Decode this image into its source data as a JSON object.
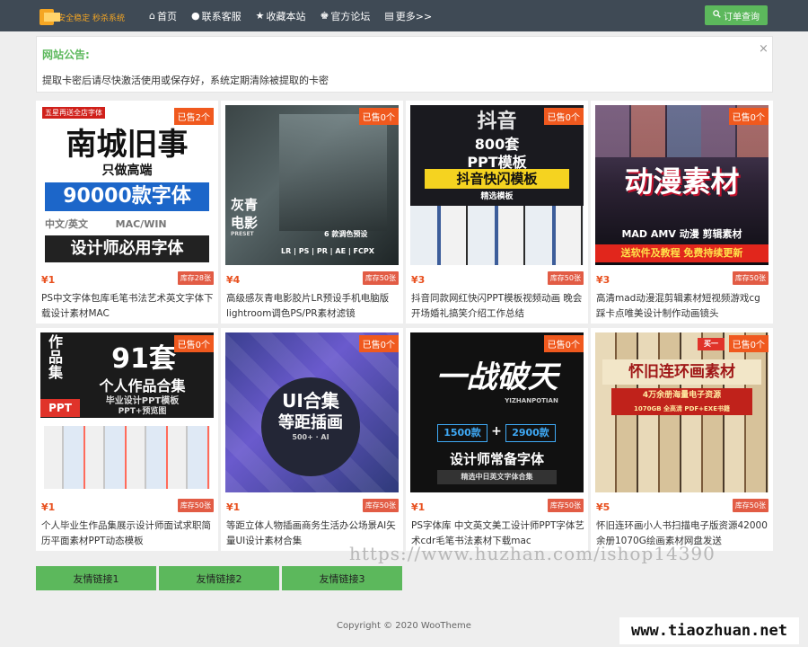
{
  "nav": {
    "logo_text": "安全稳定 秒杀系统",
    "items": [
      {
        "icon": "home-icon",
        "glyph": "⌂",
        "label": "首页"
      },
      {
        "icon": "user-icon",
        "glyph": "●",
        "label": "联系客服"
      },
      {
        "icon": "star-icon",
        "glyph": "★",
        "label": "收藏本站"
      },
      {
        "icon": "users-icon",
        "glyph": "♚",
        "label": "官方论坛"
      },
      {
        "icon": "list-icon",
        "glyph": "▤",
        "label": "更多>>"
      }
    ],
    "order_button": {
      "icon": "search-icon",
      "glyph": "🔍",
      "label": "订单查询"
    }
  },
  "notice": {
    "title": "网站公告:",
    "close": "×",
    "text": "提取卡密后请尽快激活使用或保存好，系统定期清除被提取的卡密"
  },
  "products": [
    {
      "sold": "已售2个",
      "price": "¥1",
      "stock": "库存28张",
      "title": "PS中文字体包库毛笔书法艺术英文字体下载设计素材MAC",
      "art": {
        "top": "五星再送全店字体",
        "main": "南城旧事",
        "sub": "只做高端",
        "big": "90000款字体",
        "row": "中文/英文        MAC/WIN",
        "bottom": "设计师必用字体"
      }
    },
    {
      "sold": "已售0个",
      "price": "¥4",
      "stock": "库存50张",
      "title": "高级感灰青电影胶片LR预设手机电脑版lightroom调色PS/PR素材滤镜",
      "art": {
        "label1": "灰青",
        "label2": "电影",
        "preset": "PRESET",
        "count": "6 款调色预设",
        "tools": "LR | PS | PR | AE | FCPX"
      }
    },
    {
      "sold": "已售0个",
      "price": "¥3",
      "stock": "库存50张",
      "title": "抖音同款网红快闪PPT模板视频动画 晚会开场婚礼搞笑介绍工作总结",
      "art": {
        "top": "抖音",
        "count": "800套",
        "ppt": "PPT模板",
        "main": "抖音快闪模板",
        "sub": "精选模板"
      }
    },
    {
      "sold": "已售0个",
      "price": "¥3",
      "stock": "库存50张",
      "title": "高清mad动漫混剪辑素材短视频游戏cg踩卡点唯美设计制作动画镜头",
      "art": {
        "main": "动漫素材",
        "sub": "MAD AMV 动漫 剪辑素材",
        "bottom": "送软件及教程  免费持续更新"
      }
    },
    {
      "sold": "已售0个",
      "price": "¥1",
      "stock": "库存50张",
      "title": "个人毕业生作品集展示设计师面试求职简历平面素材PPT动态模板",
      "art": {
        "side": "作品集",
        "num": "91套",
        "main": "个人作品合集",
        "sub": "毕业设计PPT模板",
        "sub2": "PPT+预览图",
        "ppt": "PPT"
      }
    },
    {
      "sold": "已售0个",
      "price": "¥1",
      "stock": "库存50张",
      "title": "等距立体人物插画商务生活办公场景AI矢量UI设计素材合集",
      "art": {
        "main": "UI合集",
        "sub": "等距插画",
        "count": "500+ · AI"
      }
    },
    {
      "sold": "已售0个",
      "price": "¥1",
      "stock": "库存50张",
      "title": "PS字体库 中文英文美工设计师PPT字体艺术cdr毛笔书法素材下载mac",
      "art": {
        "main": "一战破天",
        "pin": "YIZHANPOTIAN",
        "n1": "1500款",
        "n2": "2900款",
        "main2": "设计师常备字体",
        "sub": "精选中日英文字体合集"
      }
    },
    {
      "sold": "已售0个",
      "price": "¥5",
      "stock": "库存50张",
      "title": "怀旧连环画小人书扫描电子版资源42000余册1070G绘画素材网盘发送",
      "art": {
        "tag": "买一",
        "main": "怀旧连环画素材",
        "sub": "4万余册海量电子资源",
        "sub2": "1070GB 全高清 PDF+EXE书籍"
      }
    }
  ],
  "links": [
    "友情链接1",
    "友情链接2",
    "友情链接3"
  ],
  "footer": "Copyright © 2020 WooTheme",
  "watermarks": [
    "https://www.huzhan.com/ishop14390",
    "www.tiaozhuan.net"
  ],
  "colors": {
    "nav_bg": "#3f4a55",
    "accent_green": "#5cb85c",
    "sold_orange": "#f0591e",
    "price_red": "#e8501f"
  }
}
